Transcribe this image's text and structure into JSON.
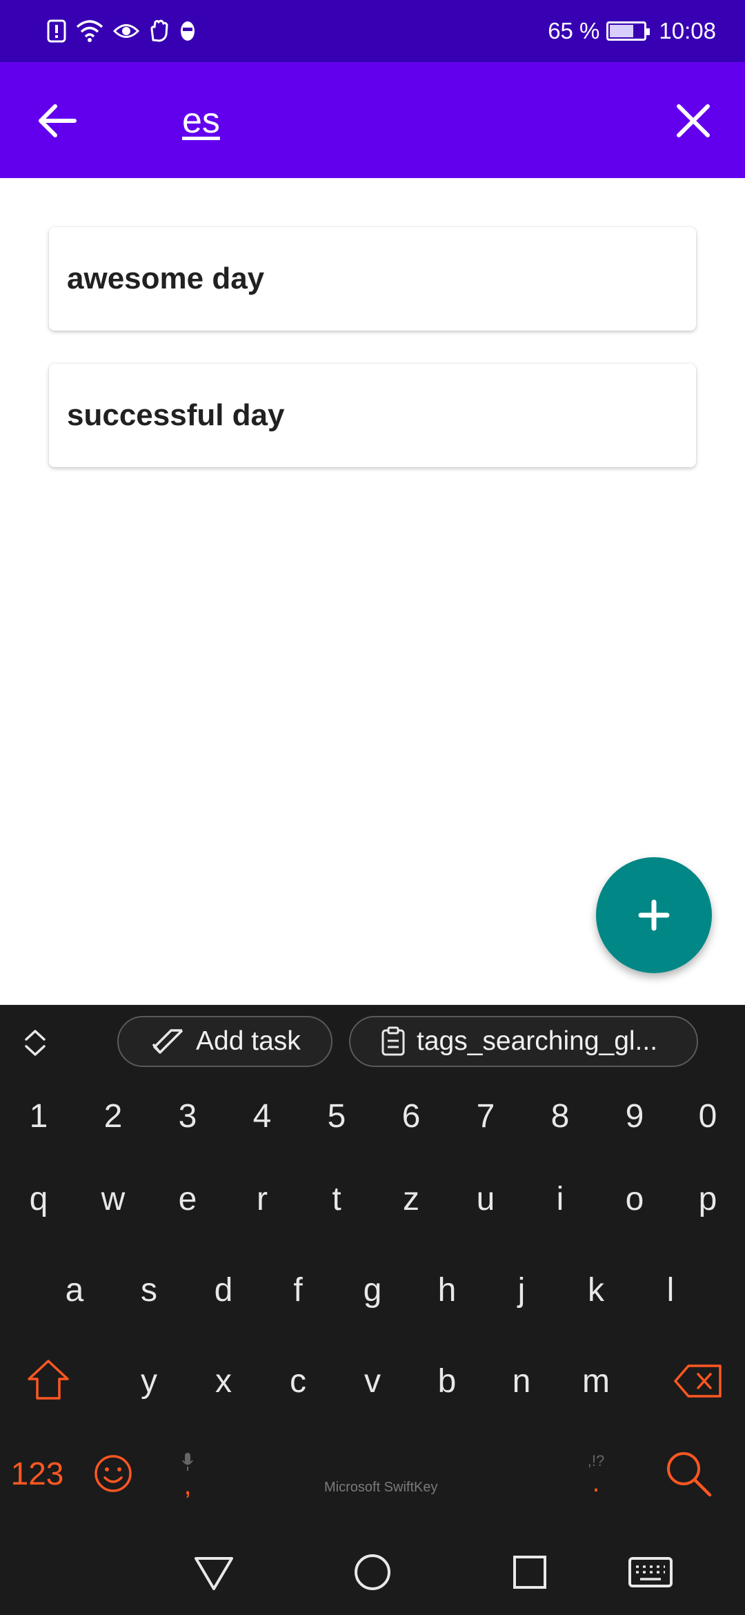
{
  "status_bar": {
    "battery_text": "65 %",
    "battery_level": 0.65,
    "time": "10:08",
    "icons": [
      "alert-icon",
      "wifi-icon",
      "eye-icon",
      "hand-icon",
      "mask-icon"
    ]
  },
  "app_bar": {
    "search_value": "es",
    "back_icon": "arrow-left-icon",
    "clear_icon": "close-icon"
  },
  "results": [
    {
      "title": "awesome day"
    },
    {
      "title": "successful day"
    }
  ],
  "fab": {
    "icon": "plus-icon",
    "color": "#018786"
  },
  "keyboard": {
    "toolbar": {
      "add_task_label": "Add task",
      "clipboard_label": "tags_searching_gl..."
    },
    "number_row": [
      "1",
      "2",
      "3",
      "4",
      "5",
      "6",
      "7",
      "8",
      "9",
      "0"
    ],
    "row1": [
      "q",
      "w",
      "e",
      "r",
      "t",
      "z",
      "u",
      "i",
      "o",
      "p"
    ],
    "row2": [
      "a",
      "s",
      "d",
      "f",
      "g",
      "h",
      "j",
      "k",
      "l"
    ],
    "row3": [
      "y",
      "x",
      "c",
      "v",
      "b",
      "n",
      "m"
    ],
    "symbols_key": "123",
    "comma_key": ",",
    "period_key": ".",
    "punct_hint": ",!?",
    "space_label": "Microsoft SwiftKey",
    "accent_color": "#ff5722"
  },
  "colors": {
    "status_bar": "#3700b3",
    "app_bar": "#6200ee"
  }
}
